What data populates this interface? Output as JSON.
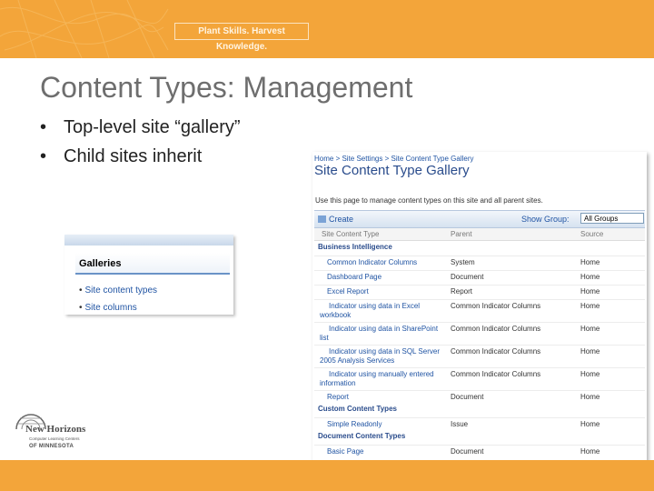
{
  "banner": {
    "tagline": "Plant Skills. Harvest Knowledge."
  },
  "slide": {
    "title": "Content Types: Management",
    "bullets": [
      "Top-level site “gallery”",
      "Child sites inherit"
    ]
  },
  "galleries_panel": {
    "heading": "Galleries",
    "items": [
      "Site content types",
      "Site columns"
    ]
  },
  "sharepoint": {
    "breadcrumb": "Home > Site Settings > Site Content Type Gallery",
    "page_title": "Site Content Type Gallery",
    "description": "Use this page to manage content types on this site and all parent sites.",
    "toolbar": {
      "create_label": "Create",
      "show_group_label": "Show Group:",
      "group_select_value": "All Groups"
    },
    "columns": [
      "Site Content Type",
      "Parent",
      "Source"
    ],
    "groups": [
      {
        "name": "Business Intelligence",
        "rows": [
          {
            "name": "Common Indicator Columns",
            "parent": "System",
            "source": "Home"
          },
          {
            "name": "Dashboard Page",
            "parent": "Document",
            "source": "Home"
          },
          {
            "name": "Excel Report",
            "parent": "Report",
            "source": "Home"
          },
          {
            "name": "Indicator using data in Excel workbook",
            "parent": "Common Indicator Columns",
            "source": "Home"
          },
          {
            "name": "Indicator using data in SharePoint list",
            "parent": "Common Indicator Columns",
            "source": "Home"
          },
          {
            "name": "Indicator using data in SQL Server 2005 Analysis Services",
            "parent": "Common Indicator Columns",
            "source": "Home"
          },
          {
            "name": "Indicator using manually entered information",
            "parent": "Common Indicator Columns",
            "source": "Home"
          },
          {
            "name": "Report",
            "parent": "Document",
            "source": "Home"
          }
        ]
      },
      {
        "name": "Custom Content Types",
        "rows": [
          {
            "name": "Simple Readonly",
            "parent": "Issue",
            "source": "Home"
          }
        ]
      },
      {
        "name": "Document Content Types",
        "rows": [
          {
            "name": "Basic Page",
            "parent": "Document",
            "source": "Home"
          }
        ]
      }
    ]
  },
  "logo": {
    "name": "New Horizons",
    "subtitle": "Computer Learning Centers",
    "state": "OF MINNESOTA"
  },
  "colors": {
    "accent": "#f3a53a",
    "title": "#6e6e6e",
    "link": "#2054a3"
  }
}
